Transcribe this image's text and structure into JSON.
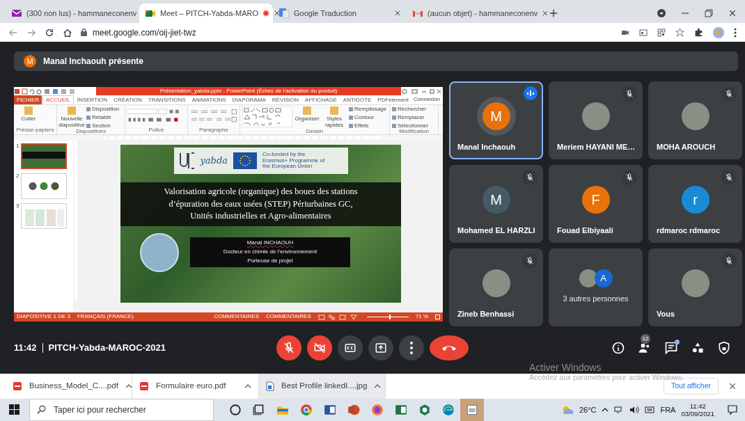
{
  "browser": {
    "tabs": [
      {
        "title": "(300 non lus) - hammaneconenv",
        "kind": "mail",
        "selected": false,
        "recording": false
      },
      {
        "title": "Meet – PITCH-Yabda-MARO",
        "kind": "meet",
        "selected": true,
        "recording": true
      },
      {
        "title": "Google Traduction",
        "kind": "translate",
        "selected": false,
        "recording": false
      },
      {
        "title": "(aucun objet) - hammaneconenv",
        "kind": "gmail",
        "selected": false,
        "recording": false
      }
    ],
    "address": "meet.google.com/oij-jiet-twz"
  },
  "meet": {
    "banner": {
      "initial": "M",
      "text": "Manal Inchaouh présente"
    },
    "presentation": {
      "title": "Présentation_yabda.pptx - PowerPoint (Échec de l'activation du produit)",
      "account": "Connexion",
      "tabs": [
        {
          "label": "FICHIER",
          "kind": "file",
          "selected": false
        },
        {
          "label": "ACCUEIL",
          "kind": "tab",
          "selected": true
        },
        {
          "label": "INSERTION",
          "kind": "tab",
          "selected": false
        },
        {
          "label": "CRÉATION",
          "kind": "tab",
          "selected": false
        },
        {
          "label": "TRANSITIONS",
          "kind": "tab",
          "selected": false
        },
        {
          "label": "ANIMATIONS",
          "kind": "tab",
          "selected": false
        },
        {
          "label": "DIAPORAMA",
          "kind": "tab",
          "selected": false
        },
        {
          "label": "RÉVISION",
          "kind": "tab",
          "selected": false
        },
        {
          "label": "AFFICHAGE",
          "kind": "tab",
          "selected": false
        },
        {
          "label": "ANTIDOTE",
          "kind": "tab",
          "selected": false
        },
        {
          "label": "PDFelement",
          "kind": "tab",
          "selected": false
        }
      ],
      "ribbon_groups": [
        {
          "name": "Presse-papiers",
          "kind": "clipboard",
          "buttons": [
            "Coller"
          ]
        },
        {
          "name": "Diapositives",
          "kind": "slides",
          "buttons": [
            "Nouvelle diapositive",
            "Disposition",
            "Rétablir",
            "Section"
          ]
        },
        {
          "name": "Police",
          "kind": "font"
        },
        {
          "name": "Paragraphe",
          "kind": "paragraph"
        },
        {
          "name": "Dessin",
          "kind": "drawing",
          "buttons": [
            "Organiser",
            "Styles rapides",
            "Remplissage",
            "Contour",
            "Effets"
          ]
        },
        {
          "name": "Modification",
          "kind": "editing",
          "buttons": [
            "Rechercher",
            "Remplacer",
            "Sélectionner"
          ]
        }
      ],
      "thumbnails": [
        {
          "number": "1",
          "kind": "title",
          "selected": true
        },
        {
          "number": "2",
          "kind": "icons",
          "selected": false
        },
        {
          "number": "3",
          "kind": "table",
          "selected": false
        }
      ],
      "slide": {
        "logo_text": "yabda",
        "eu_text": "Co-funded by the Erasmus+ Programme of the European Union",
        "title_lines": [
          "Valorisation agricole (organique) des boues des stations",
          "d’épuration des eaux usées (STEP) Périurbaines GC,",
          "Unités industrielles et  Agro-alimentaires"
        ],
        "presenter_name": "Manal INCHAOUH",
        "presenter_lines": [
          "Docteur en chimie de l’environnement",
          "Porteuse de projet"
        ]
      },
      "status": {
        "slide": "DIAPOSITIVE 1 DE 3",
        "language": "FRANÇAIS (FRANCE)",
        "notes": "COMMENTAIRES",
        "comments": "COMMENTAIRES",
        "zoom": "71 %",
        "level": 0.55
      }
    },
    "participants": [
      {
        "kind": "letter",
        "name": "Manal Inchaouh",
        "initial": "M",
        "color": "#e8710a",
        "muted": false,
        "speaking": true,
        "selected": true
      },
      {
        "kind": "photo",
        "name": "Meriem HAYANI ME…",
        "muted": true,
        "speaking": false,
        "selected": false
      },
      {
        "kind": "photo",
        "name": "MOHA AROUCH",
        "muted": true,
        "speaking": false,
        "selected": false
      },
      {
        "kind": "letter",
        "name": "Mohamed EL HARZLI",
        "initial": "M",
        "color": "#455a64",
        "muted": true,
        "speaking": false,
        "selected": false
      },
      {
        "kind": "letter",
        "name": "Fouad Elbiyaali",
        "initial": "F",
        "color": "#e8710a",
        "muted": true,
        "speaking": false,
        "selected": false
      },
      {
        "kind": "letter",
        "name": "rdmaroc rdmaroc",
        "initial": "r",
        "color": "#1a8ad4",
        "muted": true,
        "speaking": false,
        "selected": false
      },
      {
        "kind": "photo",
        "name": "Zineb Benhassi",
        "muted": true,
        "speaking": false,
        "selected": false
      },
      {
        "kind": "others",
        "name": "3 autres personnes",
        "avatars": [
          {
            "kind": "photo"
          },
          {
            "kind": "letter",
            "initial": "A",
            "color": "#1967d2"
          }
        ],
        "muted": false,
        "speaking": false,
        "selected": false
      },
      {
        "kind": "photo",
        "name": "Vous",
        "muted": true,
        "speaking": false,
        "selected": false
      }
    ],
    "bar": {
      "time": "11:42",
      "meeting": "PITCH-Yabda-MAROC-2021",
      "controls": [
        {
          "kind": "mic",
          "on": false
        },
        {
          "kind": "camera",
          "on": false
        },
        {
          "kind": "captions",
          "on": false
        },
        {
          "kind": "present",
          "on": false
        },
        {
          "kind": "more"
        },
        {
          "kind": "hangup"
        }
      ],
      "side": [
        {
          "kind": "info"
        },
        {
          "kind": "people",
          "badge": "12"
        },
        {
          "kind": "chat",
          "dot": true
        },
        {
          "kind": "activities"
        },
        {
          "kind": "host"
        }
      ]
    }
  },
  "downloads": {
    "items": [
      {
        "name": "Business_Model_C....pdf",
        "kind": "pdf",
        "selected": false
      },
      {
        "name": "Formulaire euro.pdf",
        "kind": "pdf",
        "selected": false
      },
      {
        "name": "Best Profile linkedI....jpg",
        "kind": "image",
        "selected": true
      }
    ],
    "show_all": "Tout afficher"
  },
  "windows_notice": {
    "title": "Activer Windows",
    "text": "Accédez aux paramètres pour activer Windows."
  },
  "taskbar": {
    "search_placeholder": "Taper ici pour rechercher",
    "apps": [
      {
        "kind": "cortana",
        "selected": false
      },
      {
        "kind": "taskview",
        "selected": false
      },
      {
        "kind": "explorer",
        "selected": false
      },
      {
        "kind": "chrome",
        "selected": false
      },
      {
        "kind": "word",
        "selected": false
      },
      {
        "kind": "powerpoint",
        "selected": false
      },
      {
        "kind": "firefox",
        "selected": false
      },
      {
        "kind": "excel",
        "selected": false
      },
      {
        "kind": "app",
        "selected": false
      },
      {
        "kind": "edge",
        "selected": false
      },
      {
        "kind": "viewer",
        "selected": true
      }
    ],
    "temperature": "26°C",
    "language": "FRA",
    "time": "11:42",
    "date": "03/09/2021"
  }
}
